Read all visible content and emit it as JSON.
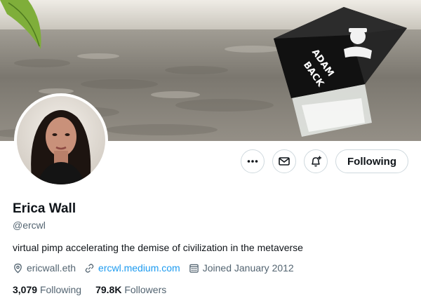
{
  "profile": {
    "name": "Erica Wall",
    "handle": "@ercwl",
    "bio": "virtual pimp accelerating the demise of civilization in the metaverse",
    "location": "ericwall.eth",
    "website": "ercwl.medium.com",
    "joined": "Joined January 2012"
  },
  "banner": {
    "cube_text_line1": "ADAM",
    "cube_text_line2": "BACK"
  },
  "actions": {
    "more_icon": "more-dots-icon",
    "message_icon": "envelope-icon",
    "notify_icon": "bell-plus-icon",
    "following_label": "Following"
  },
  "stats": {
    "following_count": "3,079",
    "following_label": "Following",
    "followers_count": "79.8K",
    "followers_label": "Followers"
  },
  "colors": {
    "accent": "#1d9bf0",
    "text_primary": "#0f1419",
    "text_secondary": "#536471",
    "border": "#cfd9de"
  }
}
